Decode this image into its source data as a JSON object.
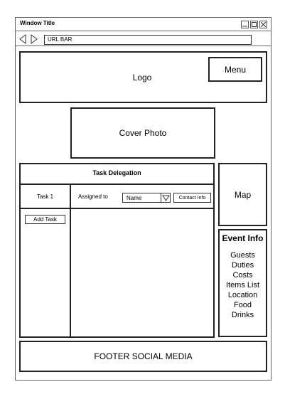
{
  "window": {
    "title": "Window Title"
  },
  "browser": {
    "url_bar": "URL BAR"
  },
  "header": {
    "logo": "Logo",
    "menu": "Menu"
  },
  "cover_photo": "Cover Photo",
  "task_panel": {
    "title": "Task Delegation",
    "tasks": [
      "Task 1"
    ],
    "add_task_label": "Add Task",
    "assigned_to_label": "Assigned to",
    "assignee_selected": "Name",
    "contact_info_label": "Contact Info"
  },
  "map_label": "Map",
  "event_info": {
    "title": "Event Info",
    "items": [
      "Guests",
      "Duties",
      "Costs",
      "Items List",
      "Location",
      "Food",
      "Drinks"
    ]
  },
  "footer": "FOOTER SOCIAL MEDIA"
}
